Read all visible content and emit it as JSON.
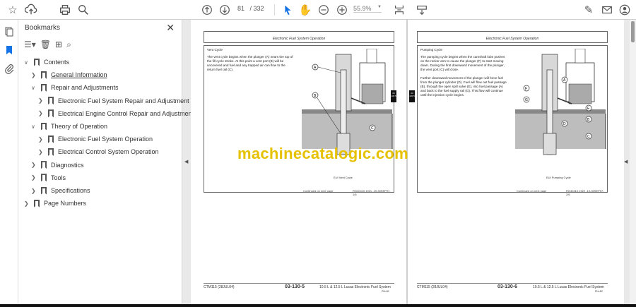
{
  "toolbar": {
    "page_current": "81",
    "page_total": "/ 332",
    "zoom": "55.9%"
  },
  "bookmarks": {
    "title": "Bookmarks",
    "items": [
      {
        "label": "Contents",
        "level": 0,
        "expanded": true
      },
      {
        "label": "General Information",
        "level": 1,
        "expanded": false
      },
      {
        "label": "Repair and Adjustments",
        "level": 1,
        "expanded": true
      },
      {
        "label": "Electronic Fuel System Repair and Adjustment",
        "level": 2,
        "expanded": false
      },
      {
        "label": "Electrical Engine Control Repair and Adjustment",
        "level": 2,
        "expanded": false
      },
      {
        "label": "Theory of Operation",
        "level": 1,
        "expanded": true
      },
      {
        "label": "Electronic Fuel System Operation",
        "level": 2,
        "expanded": false
      },
      {
        "label": "Electrical Control System Operation",
        "level": 2,
        "expanded": false
      },
      {
        "label": "Diagnostics",
        "level": 1,
        "expanded": false
      },
      {
        "label": "Tools",
        "level": 1,
        "expanded": false
      },
      {
        "label": "Specifications",
        "level": 1,
        "expanded": false
      },
      {
        "label": "Page Numbers",
        "level": 0,
        "expanded": false
      }
    ]
  },
  "pages": [
    {
      "header": "Electronic Fuel System Operation",
      "heading": "Vent Cycle",
      "text": "The vent cycle begins when the plunger (A) nears the top of the fill cycle stroke. At this point a vent port (B) will be uncovered and fuel and any trapped air can flow to the return fuel rail (C).",
      "caption": "EUI Vent Cycle",
      "continued": "Continued on next page",
      "ref": "RG40410,1921   -19-30SEP97-1/6",
      "footer_left": "CTM115 (28JUL04)",
      "footer_num": "03-130-5",
      "footer_right": "10.5 L & 12.5 L Lucas Electronic Fuel System",
      "footer_sub": "PN=81"
    },
    {
      "header": "Electronic Fuel System Operation",
      "heading": "Pumping Cycle",
      "text": "The pumping cycle begins when the camshaft lobe pushes on the rocker arm to cause the plunger (F) to start moving down. During the first downward movement of the plunger, the vent port (C) will close.",
      "text2": "Further downward movement of the plunger will force fuel from the plunger cylinder (D). Fuel will flow out fuel passage (B), through the open spill valve (E), into fuel passage (A) and back to the fuel supply rail (G). This flow will continue until the injection cycle begins.",
      "caption": "EUI Pumping Cycle",
      "continued": "Continued on next page",
      "ref": "RG40410,1922   -19-30SEP97-2/6",
      "footer_left": "CTM115 (28JUL04)",
      "footer_num": "03-130-6",
      "footer_right": "10.5 L & 12.5 L Lucas Electronic Fuel System",
      "footer_sub": "PN=82"
    }
  ],
  "section_tab": "03 130 5",
  "watermark": "machinecatalogic.com"
}
